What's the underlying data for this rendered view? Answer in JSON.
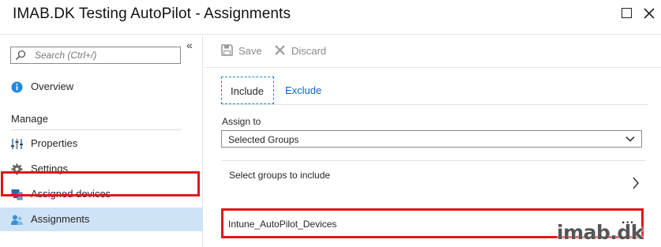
{
  "window": {
    "title": "IMAB.DK Testing AutoPilot - Assignments"
  },
  "sidebar": {
    "collapse_glyph": "«",
    "search_placeholder": "Search (Ctrl+/)",
    "overview": {
      "label": "Overview",
      "icon": "info-icon"
    },
    "section_label": "Manage",
    "items": [
      {
        "label": "Properties",
        "icon": "properties-icon"
      },
      {
        "label": "Settings",
        "icon": "gear-icon"
      },
      {
        "label": "Assigned devices",
        "icon": "devices-icon"
      },
      {
        "label": "Assignments",
        "icon": "users-icon",
        "active": true
      }
    ]
  },
  "toolbar": {
    "save_label": "Save",
    "discard_label": "Discard"
  },
  "tabs": {
    "include": "Include",
    "exclude": "Exclude"
  },
  "form": {
    "assign_to_label": "Assign to",
    "assign_to_value": "Selected Groups",
    "select_groups_label": "Select groups to include",
    "group_name": "Intune_AutoPilot_Devices",
    "more_glyph": "..."
  },
  "watermark": "imab.dk",
  "colors": {
    "accent": "#0a64c8",
    "highlight": "#e3141e",
    "active_bg": "#cfe3f7"
  }
}
